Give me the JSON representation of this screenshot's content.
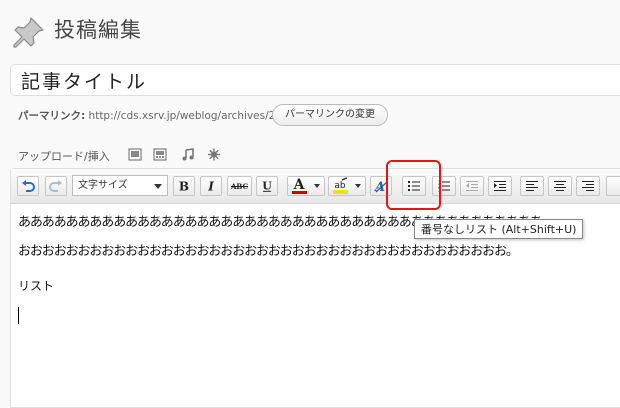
{
  "header": {
    "title": "投稿編集",
    "icon": "pushpin-icon"
  },
  "post": {
    "title_value": "記事タイトル"
  },
  "permalink": {
    "label": "パーマリンク:",
    "url": "http://cds.xsrv.jp/weblog/archives/29",
    "change_button": "パーマリンクの変更"
  },
  "media": {
    "label": "アップロード/挿入",
    "icons": [
      "image-icon",
      "video-icon",
      "audio-icon",
      "media-icon"
    ]
  },
  "toolbar": {
    "format_select": "文字サイズ",
    "strike_label": "ABC",
    "tooltip": "番号なしリスト (Alt+Shift+U)"
  },
  "content": {
    "line1": "ああああああああああああああああああああああああああああああああああああああああああああ",
    "line2": "おおおおおおおおおおおおおおおおおおおおおおおおおおおおおおおおおおおおおおおおお。",
    "line3": "リスト"
  },
  "colors": {
    "highlight": "#ee1111",
    "text_color_bar": "#cc0000",
    "bg_color_bar": "#e6e600"
  }
}
